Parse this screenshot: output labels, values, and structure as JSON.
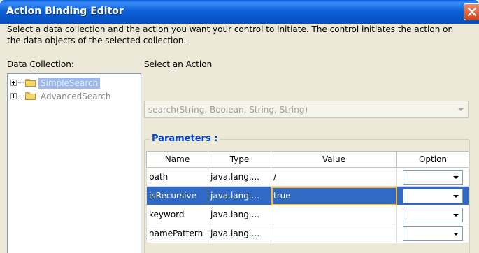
{
  "window": {
    "title": "Action Binding Editor"
  },
  "instructions": "Select a data collection and the action you want your control to initiate. The control initiates the action on the data objects of the selected collection.",
  "data_collection": {
    "label_prefix": "Data ",
    "label_mnemonic": "C",
    "label_suffix": "ollection:",
    "items": [
      {
        "label": "SimpleSearch",
        "selected": true
      },
      {
        "label": "AdvancedSearch",
        "selected": false
      }
    ]
  },
  "action": {
    "label_prefix": "Select ",
    "label_mnemonic": "a",
    "label_suffix": "n Action",
    "selected_value": "search(String, Boolean, String, String)"
  },
  "parameters": {
    "legend": "Parameters :",
    "columns": [
      "Name",
      "Type",
      "Value",
      "Option"
    ],
    "rows": [
      {
        "name": "path",
        "type": "java.lang....",
        "value": "/",
        "option": ""
      },
      {
        "name": "isRecursive",
        "type": "java.lang....",
        "value": "true",
        "option": ""
      },
      {
        "name": "keyword",
        "type": "java.lang....",
        "value": "",
        "option": ""
      },
      {
        "name": "namePattern",
        "type": "java.lang....",
        "value": "",
        "option": ""
      }
    ]
  },
  "colors": {
    "titlebar": "#0d62d9",
    "selection": "#316ac5",
    "legend_text": "#0046d5",
    "close_button": "#d8421c"
  }
}
